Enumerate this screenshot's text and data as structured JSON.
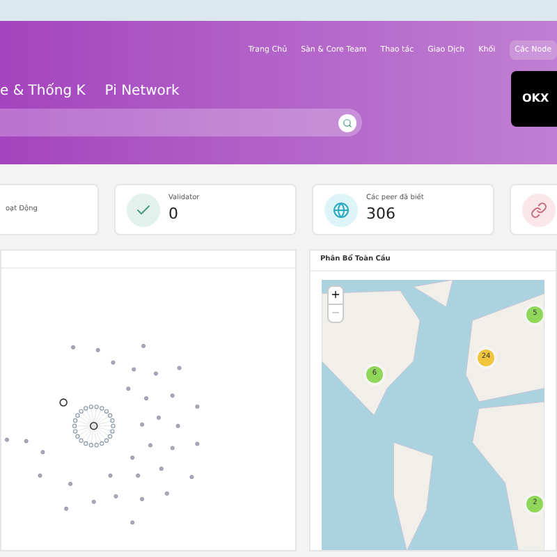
{
  "nav": [
    {
      "label": "Trang Chủ",
      "selected": false
    },
    {
      "label": "Sàn & Core Team",
      "selected": false
    },
    {
      "label": "Thao tác",
      "selected": false
    },
    {
      "label": "Giao Dịch",
      "selected": false
    },
    {
      "label": "Khối",
      "selected": false
    },
    {
      "label": "Các Node",
      "selected": true
    }
  ],
  "title_parts": [
    "e & Thống K",
    "Pi Network"
  ],
  "ad": {
    "logo": "OKX"
  },
  "stats": [
    {
      "kind": "none",
      "label": "oạt Động"
    },
    {
      "kind": "check",
      "label": "Validator",
      "value": "0",
      "color": "#e3f1ec"
    },
    {
      "kind": "globe",
      "label": "Các peer đã biết",
      "value": "306",
      "color": "#def5f7"
    },
    {
      "kind": "link",
      "color": "#fbe6ea"
    }
  ],
  "map_panel": {
    "title": "Phân Bổ Toàn Cầu",
    "zoom_in": "+",
    "zoom_out": "−",
    "clusters": [
      {
        "count": "5",
        "color": "#8fd65a"
      },
      {
        "count": "24",
        "color": "#f2c43c"
      },
      {
        "count": "6",
        "color": "#8fd65a"
      },
      {
        "count": "2",
        "color": "#8fd65a"
      }
    ]
  }
}
